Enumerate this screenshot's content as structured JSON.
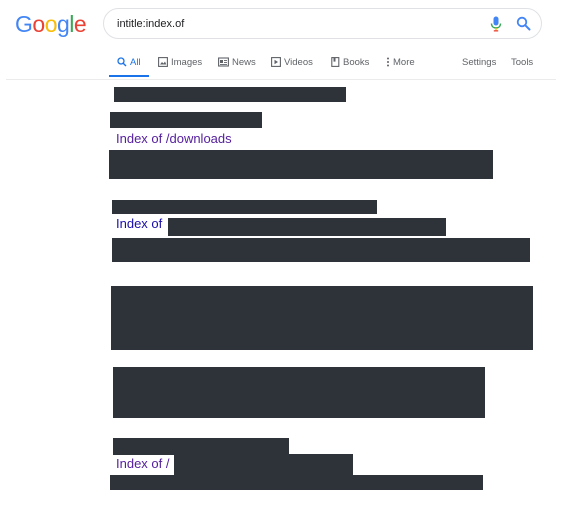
{
  "logo": {
    "letters": [
      "G",
      "o",
      "o",
      "g",
      "l",
      "e"
    ],
    "colors": [
      "#4285f4",
      "#ea4335",
      "#fbbc05",
      "#4285f4",
      "#34a853",
      "#ea4335"
    ]
  },
  "search": {
    "query": "intitle:index.of"
  },
  "tabs": {
    "all": "All",
    "images": "Images",
    "news": "News",
    "videos": "Videos",
    "books": "Books",
    "more": "More",
    "settings": "Settings",
    "tools": "Tools"
  },
  "results": {
    "result1_title": "Index of /downloads",
    "result2_title": "Index of",
    "result3_title": "Index of /"
  },
  "colors": {
    "accent": "#1a73e8",
    "visited_link": "#55209e",
    "link": "#1a0dab",
    "redaction": "#2d3339"
  }
}
